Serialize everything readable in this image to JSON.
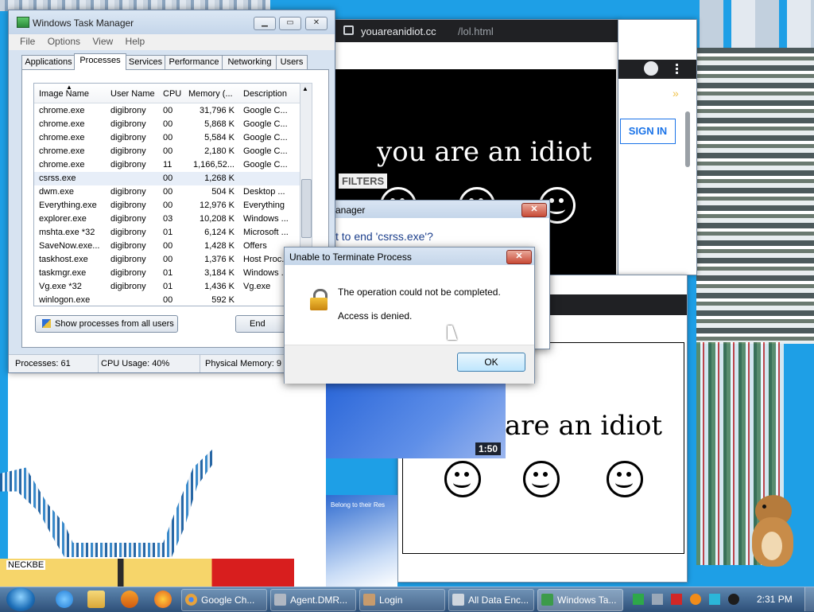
{
  "background_windows": {
    "browser": {
      "url_domain": "youareanidiot.cc",
      "url_path": "/lol.html",
      "sign_in": "SIGN IN",
      "filters": "FILTERS",
      "chevrons": "»"
    },
    "idiot_banner_text": "you are an idiot",
    "idiot_banner_text_lower": "are an idiot",
    "video_duration": "1:50",
    "partial_task_manager_title": "anager",
    "partial_confirm_text": "t to end 'csrss.exe'?",
    "partial_page_text": "Belong to their Res",
    "neckbeard_text": "NECKBE"
  },
  "task_manager": {
    "title": "Windows Task Manager",
    "menu": [
      "File",
      "Options",
      "View",
      "Help"
    ],
    "tabs": [
      "Applications",
      "Processes",
      "Services",
      "Performance",
      "Networking",
      "Users"
    ],
    "selected_tab": "Processes",
    "columns": [
      "Image Name",
      "User Name",
      "CPU",
      "Memory (...",
      "Description"
    ],
    "rows": [
      {
        "image": "chrome.exe",
        "user": "digibrony",
        "cpu": "00",
        "mem": "31,796 K",
        "desc": "Google C..."
      },
      {
        "image": "chrome.exe",
        "user": "digibrony",
        "cpu": "00",
        "mem": "5,868 K",
        "desc": "Google C..."
      },
      {
        "image": "chrome.exe",
        "user": "digibrony",
        "cpu": "00",
        "mem": "5,584 K",
        "desc": "Google C..."
      },
      {
        "image": "chrome.exe",
        "user": "digibrony",
        "cpu": "00",
        "mem": "2,180 K",
        "desc": "Google C..."
      },
      {
        "image": "chrome.exe",
        "user": "digibrony",
        "cpu": "11",
        "mem": "1,166,52...",
        "desc": "Google C..."
      },
      {
        "image": "csrss.exe",
        "user": "",
        "cpu": "00",
        "mem": "1,268 K",
        "desc": ""
      },
      {
        "image": "dwm.exe",
        "user": "digibrony",
        "cpu": "00",
        "mem": "504 K",
        "desc": "Desktop ..."
      },
      {
        "image": "Everything.exe",
        "user": "digibrony",
        "cpu": "00",
        "mem": "12,976 K",
        "desc": "Everything"
      },
      {
        "image": "explorer.exe",
        "user": "digibrony",
        "cpu": "03",
        "mem": "10,208 K",
        "desc": "Windows ..."
      },
      {
        "image": "mshta.exe *32",
        "user": "digibrony",
        "cpu": "01",
        "mem": "6,124 K",
        "desc": "Microsoft ..."
      },
      {
        "image": "SaveNow.exe...",
        "user": "digibrony",
        "cpu": "00",
        "mem": "1,428 K",
        "desc": "Offers"
      },
      {
        "image": "taskhost.exe",
        "user": "digibrony",
        "cpu": "00",
        "mem": "1,376 K",
        "desc": "Host Proc..."
      },
      {
        "image": "taskmgr.exe",
        "user": "digibrony",
        "cpu": "01",
        "mem": "3,184 K",
        "desc": "Windows ..."
      },
      {
        "image": "Vg.exe *32",
        "user": "digibrony",
        "cpu": "01",
        "mem": "1,436 K",
        "desc": "Vg.exe"
      },
      {
        "image": "winlogon.exe",
        "user": "",
        "cpu": "00",
        "mem": "592 K",
        "desc": ""
      }
    ],
    "selected_row": 5,
    "show_all_button": "Show processes from all users",
    "end_process_button": "End Proce",
    "status": {
      "processes": "Processes: 61",
      "cpu": "CPU Usage: 40%",
      "memory": "Physical Memory: 9"
    }
  },
  "error_dialog": {
    "title": "Unable to Terminate Process",
    "message": "The operation could not be completed.",
    "detail": "Access is denied.",
    "ok_button": "OK"
  },
  "taskbar": {
    "buttons": [
      {
        "label": "Google Ch...",
        "color": "#e6a23c"
      },
      {
        "label": "Agent.DMR...",
        "color": "#b0b7c2"
      },
      {
        "label": "Login",
        "color": "#c79b6d"
      },
      {
        "label": "All Data Enc...",
        "color": "#cfd6de"
      },
      {
        "label": "Windows Ta...",
        "color": "#3c9b4a"
      }
    ],
    "clock": "2:31 PM"
  },
  "colors": {
    "desktop": "#1e9fe6",
    "browser_dark": "#202124",
    "sign_in_blue": "#1a73e8",
    "taskbar": "#2d4f78"
  }
}
